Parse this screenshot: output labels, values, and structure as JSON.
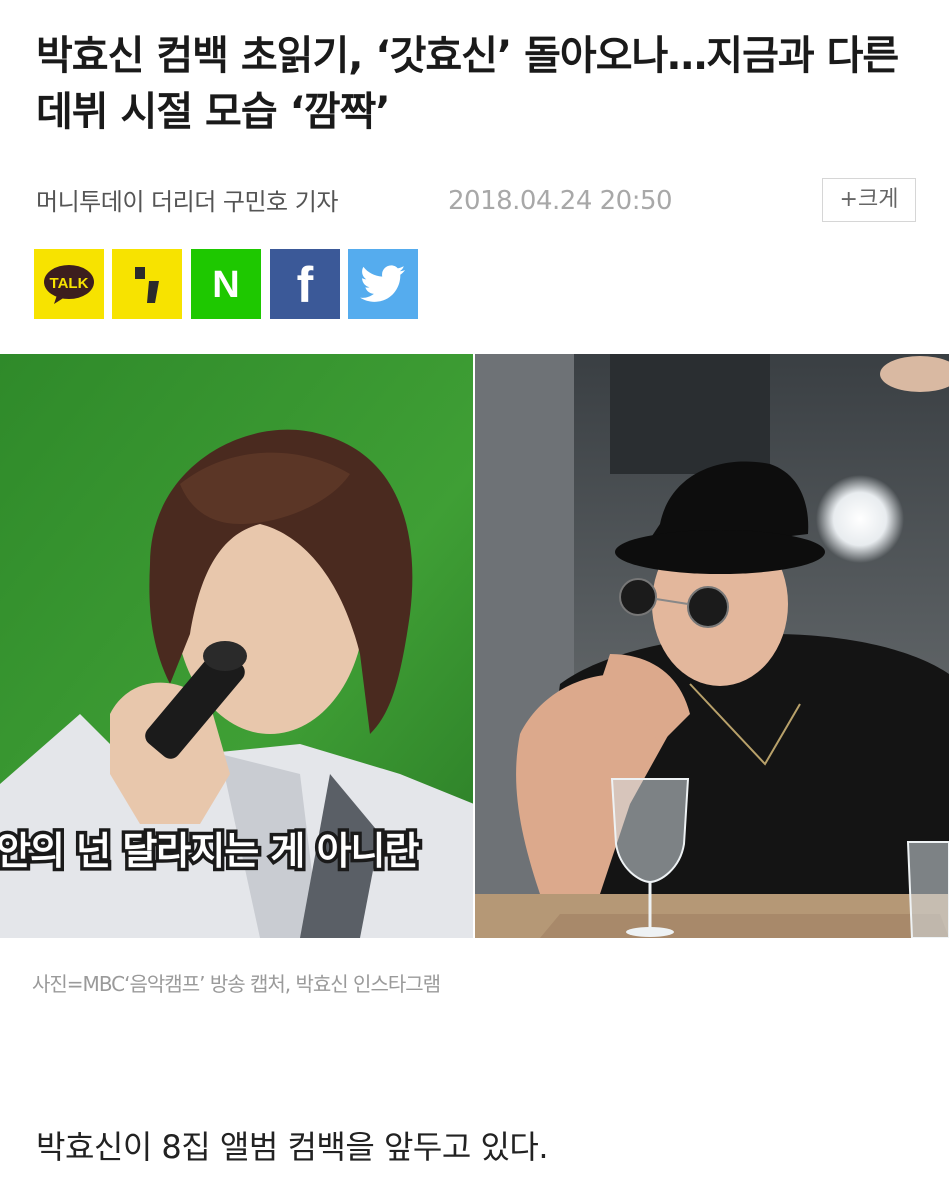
{
  "article": {
    "headline": "박효신 컴백 초읽기, ‘갓효신’ 돌아오나…지금과 다른 데뷔 시절 모습 ‘깜짝’",
    "byline": "머니투데이 더리더 구민호 기자",
    "datetime": "2018.04.24 20:50",
    "font_size_button": "+크게"
  },
  "share": {
    "kakaotalk_label": "TALK",
    "kakaostory_label": ",",
    "naver_label": "N",
    "facebook_label": "f",
    "twitter_label": ""
  },
  "photo": {
    "subtitle_text": "안의 넌 달라지는 게 아니란"
  },
  "caption": "사진=MBC‘음악캠프’ 방송 캡처, 박효신 인스타그램",
  "body": "박효신이 8집 앨범 컴백을 앞두고 있다.",
  "colors": {
    "kakao_yellow": "#F7E300",
    "naver_green": "#1EC800",
    "facebook_blue": "#3B5998",
    "twitter_blue": "#55ACEE"
  }
}
